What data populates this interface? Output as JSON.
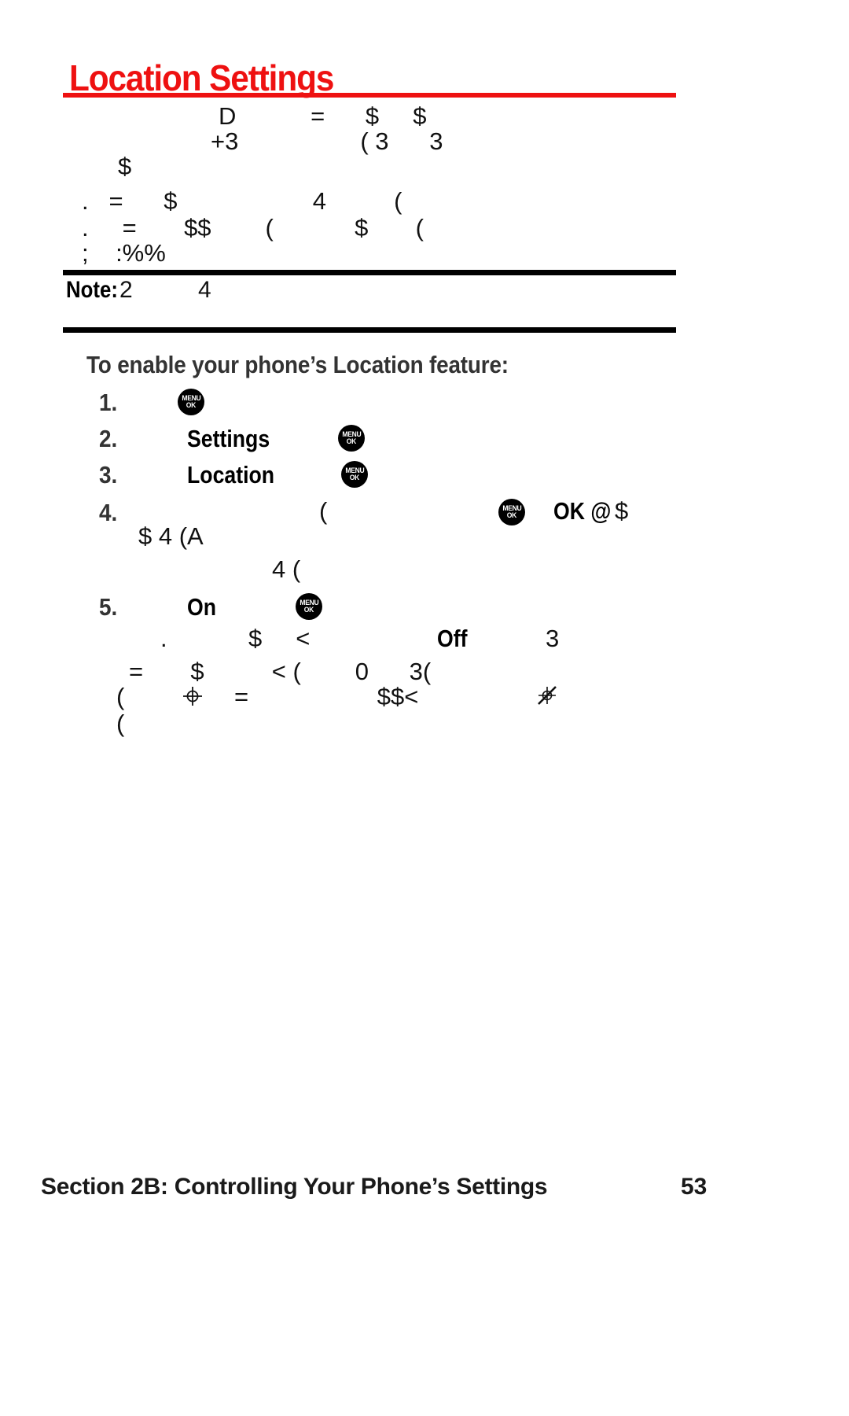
{
  "page": {
    "title": "Location Settings",
    "title_color": "#EE1111",
    "number": "53",
    "section_footer": "Section 2B: Controlling Your Phone’s Settings"
  },
  "intro": {
    "lines": [
      {
        "text": "D           =      $     $"
      },
      {
        "text": "+3                  ( 3      3"
      },
      {
        "text": "$"
      },
      {
        "text": ".   =      $                    4          ("
      },
      {
        "text": ".     =       $$        (            $       ("
      },
      {
        "text": ";    :%%"
      }
    ]
  },
  "note": {
    "label": "Note:",
    "text": "2          4"
  },
  "procedure": {
    "heading": "To enable your phone’s Location feature:",
    "steps": [
      {
        "number": "1.",
        "text": "",
        "keyword": "",
        "icon": "menu-ok-key-icon"
      },
      {
        "number": "2.",
        "text": "",
        "keyword": "Settings",
        "icon": "menu-ok-key-icon"
      },
      {
        "number": "3.",
        "text": "",
        "keyword": "Location",
        "icon": "menu-ok-key-icon"
      },
      {
        "number": "4.",
        "text": "(",
        "keyword": "OK @",
        "trailing": "$",
        "icon": "menu-ok-key-icon"
      },
      {
        "number": "5.",
        "text": "",
        "keyword": "On",
        "icon": "menu-ok-key-icon"
      }
    ],
    "step4_cont_1": "$ 4 (A",
    "step4_cont_2": "4 (",
    "step5_cont_1_a": ".            $     <",
    "step5_cont_1_kw": "Off",
    "step5_cont_1_b": "3",
    "step5_cont_2": "=       $          < (        0      3(",
    "step5_cont_3_a": "(",
    "step5_cont_3_b": "=                   $$<",
    "step5_cont_4": "("
  },
  "icons": {
    "menu_ok_top": "MENU",
    "menu_ok_bottom": "OK",
    "crosshair": "crosshair-target-icon",
    "slashed": "slashed-target-icon"
  }
}
